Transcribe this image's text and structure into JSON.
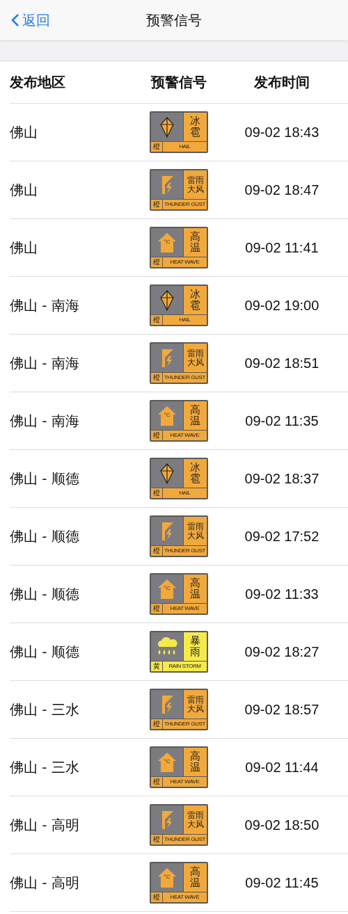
{
  "nav": {
    "back": "返回",
    "title": "预警信号"
  },
  "table": {
    "columns": [
      "发布地区",
      "预警信号",
      "发布时间"
    ],
    "rows": [
      {
        "region": "佛山",
        "time": "09-02 18:43",
        "signal": {
          "kind": "hail",
          "color": "#f2a93b",
          "lines": [
            "冰",
            "雹"
          ],
          "level": "橙",
          "label": "HAIL"
        }
      },
      {
        "region": "佛山",
        "time": "09-02 18:47",
        "signal": {
          "kind": "thunder",
          "color": "#f2a93b",
          "lines": [
            "雷雨",
            "大风"
          ],
          "level": "橙",
          "label": "THUNDER GUST"
        }
      },
      {
        "region": "佛山",
        "time": "09-02 11:41",
        "signal": {
          "kind": "heat",
          "color": "#f2a93b",
          "lines": [
            "高",
            "温"
          ],
          "level": "橙",
          "label": "HEAT WAVE",
          "icon_text": "°C"
        }
      },
      {
        "region": "佛山 - 南海",
        "time": "09-02 19:00",
        "signal": {
          "kind": "hail",
          "color": "#f2a93b",
          "lines": [
            "冰",
            "雹"
          ],
          "level": "橙",
          "label": "HAIL"
        }
      },
      {
        "region": "佛山 - 南海",
        "time": "09-02 18:51",
        "signal": {
          "kind": "thunder",
          "color": "#f2a93b",
          "lines": [
            "雷雨",
            "大风"
          ],
          "level": "橙",
          "label": "THUNDER GUST"
        }
      },
      {
        "region": "佛山 - 南海",
        "time": "09-02 11:35",
        "signal": {
          "kind": "heat",
          "color": "#f2a93b",
          "lines": [
            "高",
            "温"
          ],
          "level": "橙",
          "label": "HEAT WAVE",
          "icon_text": "°C"
        }
      },
      {
        "region": "佛山 - 顺德",
        "time": "09-02 18:37",
        "signal": {
          "kind": "hail",
          "color": "#f2a93b",
          "lines": [
            "冰",
            "雹"
          ],
          "level": "橙",
          "label": "HAIL"
        }
      },
      {
        "region": "佛山 - 顺德",
        "time": "09-02 17:52",
        "signal": {
          "kind": "thunder",
          "color": "#f2a93b",
          "lines": [
            "雷雨",
            "大风"
          ],
          "level": "橙",
          "label": "THUNDER GUST"
        }
      },
      {
        "region": "佛山 - 顺德",
        "time": "09-02 11:33",
        "signal": {
          "kind": "heat",
          "color": "#f2a93b",
          "lines": [
            "高",
            "温"
          ],
          "level": "橙",
          "label": "HEAT WAVE",
          "icon_text": "°C"
        }
      },
      {
        "region": "佛山 - 顺德",
        "time": "09-02 18:27",
        "signal": {
          "kind": "rainstorm",
          "color": "#f5ea4a",
          "lines": [
            "暴",
            "雨"
          ],
          "level": "黄",
          "label": "RAIN STORM"
        }
      },
      {
        "region": "佛山 - 三水",
        "time": "09-02 18:57",
        "signal": {
          "kind": "thunder",
          "color": "#f2a93b",
          "lines": [
            "雷雨",
            "大风"
          ],
          "level": "橙",
          "label": "THUNDER GUST"
        }
      },
      {
        "region": "佛山 - 三水",
        "time": "09-02 11:44",
        "signal": {
          "kind": "heat",
          "color": "#f2a93b",
          "lines": [
            "高",
            "温"
          ],
          "level": "橙",
          "label": "HEAT WAVE",
          "icon_text": "°C"
        }
      },
      {
        "region": "佛山 - 高明",
        "time": "09-02 18:50",
        "signal": {
          "kind": "thunder",
          "color": "#f2a93b",
          "lines": [
            "雷雨",
            "大风"
          ],
          "level": "橙",
          "label": "THUNDER GUST"
        }
      },
      {
        "region": "佛山 - 高明",
        "time": "09-02 11:45",
        "signal": {
          "kind": "heat",
          "color": "#f2a93b",
          "lines": [
            "高",
            "温"
          ],
          "level": "橙",
          "label": "HEAT WAVE",
          "icon_text": "°C"
        }
      }
    ]
  }
}
